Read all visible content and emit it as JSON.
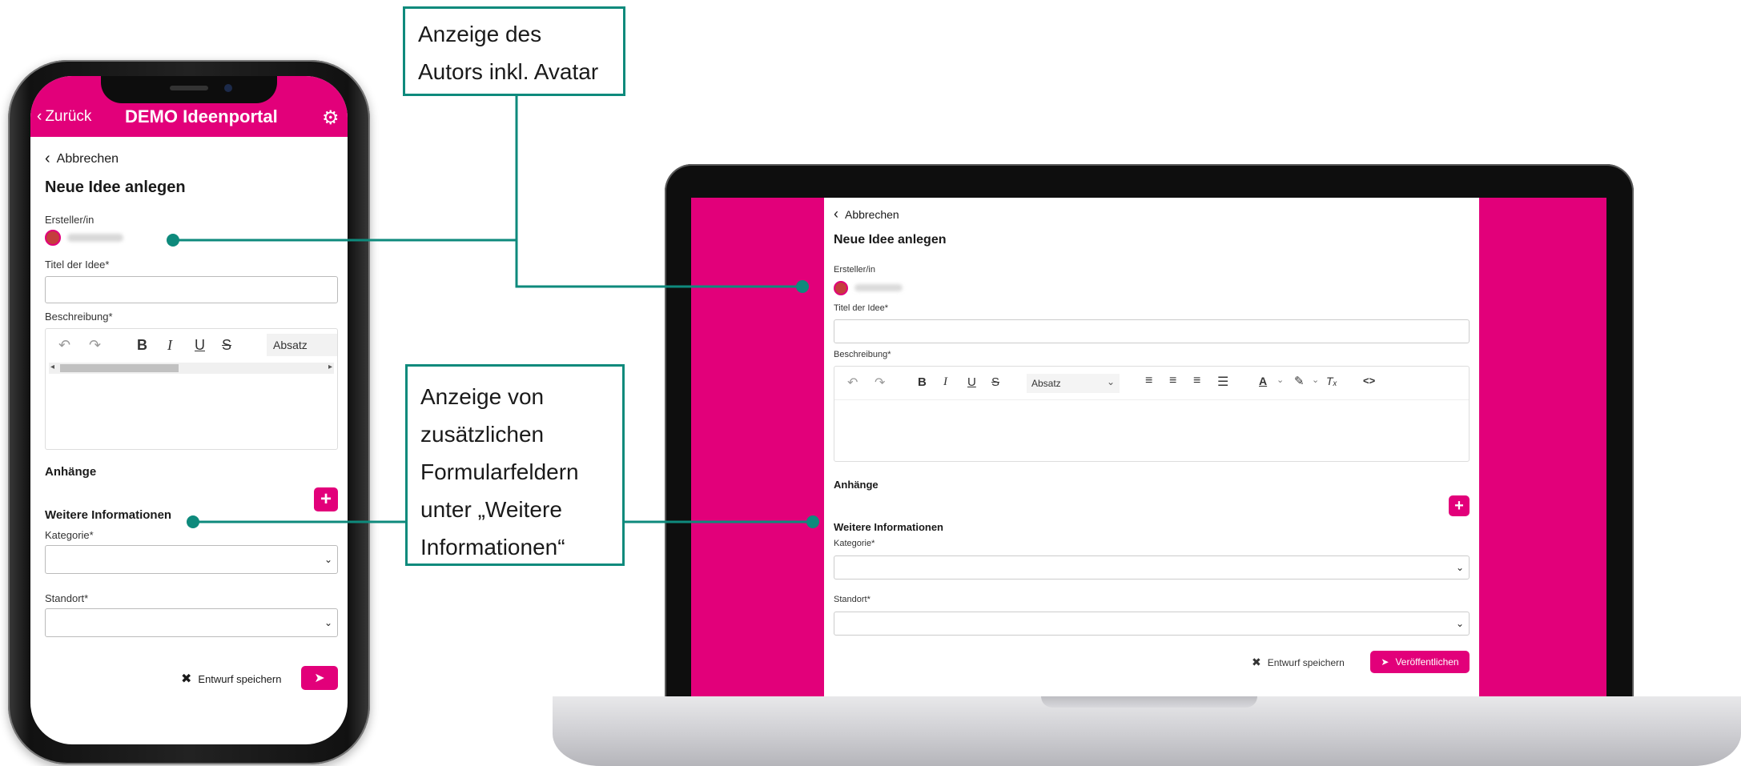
{
  "callouts": {
    "author": [
      "Anzeige des",
      "Autors inkl. Avatar"
    ],
    "fields": [
      "Anzeige von",
      "zusätzlichen",
      "Formularfeldern",
      "unter „Weitere",
      "Informationen“"
    ]
  },
  "phone": {
    "header": {
      "back_label": "Zurück",
      "title": "DEMO Ideenportal",
      "settings_icon": "gear-icon"
    },
    "cancel_label": "Abbrechen",
    "page_title": "Neue Idee anlegen",
    "creator_label": "Ersteller/in",
    "title_label": "Titel der Idee*",
    "title_value": "",
    "description_label": "Beschreibung*",
    "editor": {
      "block_format": "Absatz"
    },
    "attachments_label": "Anhänge",
    "more_info_label": "Weitere Informationen",
    "category_label": "Kategorie*",
    "location_label": "Standort*",
    "draft_label": "Entwurf speichern"
  },
  "laptop": {
    "cancel_label": "Abbrechen",
    "page_title": "Neue Idee anlegen",
    "creator_label": "Ersteller/in",
    "title_label": "Titel der Idee*",
    "description_label": "Beschreibung*",
    "editor": {
      "block_format": "Absatz"
    },
    "attachments_label": "Anhänge",
    "more_info_label": "Weitere Informationen",
    "category_label": "Kategorie*",
    "location_label": "Standort*",
    "draft_label": "Entwurf speichern",
    "publish_label": "Veröffentlichen"
  },
  "colors": {
    "brand": "#e2007a",
    "accent": "#0e8a7c"
  }
}
